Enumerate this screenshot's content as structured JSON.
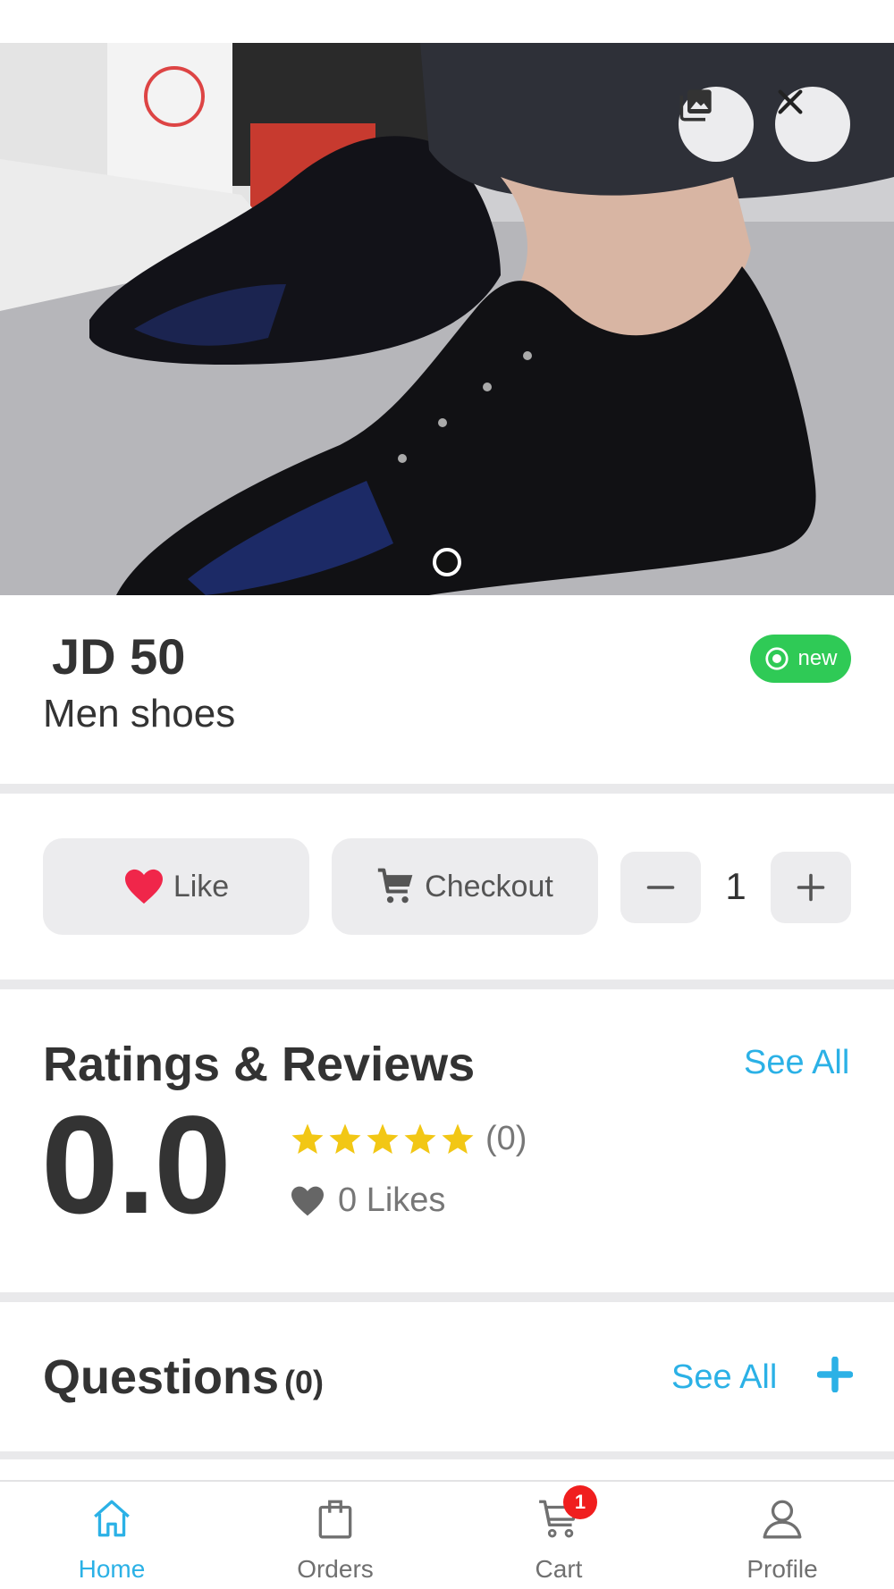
{
  "product": {
    "price": "JD 50",
    "name": "Men shoes",
    "condition_badge": "new"
  },
  "actions": {
    "like_label": "Like",
    "checkout_label": "Checkout",
    "quantity": "1"
  },
  "ratings": {
    "title": "Ratings & Reviews",
    "see_all": "See All",
    "average": "0.0",
    "stars_filled": 5,
    "review_count": "(0)",
    "likes": "0 Likes"
  },
  "questions": {
    "title": "Questions",
    "count": "(0)",
    "see_all": "See All"
  },
  "tabbar": {
    "tabs": [
      {
        "label": "Home",
        "icon": "home-icon",
        "active": true
      },
      {
        "label": "Orders",
        "icon": "shopping-bag-icon",
        "active": false
      },
      {
        "label": "Cart",
        "icon": "cart-icon",
        "active": false
      },
      {
        "label": "Profile",
        "icon": "user-icon",
        "active": false
      }
    ],
    "cart_badge": "1"
  },
  "colors": {
    "accent": "#2bb1e6",
    "badge_green": "#2fca56",
    "heart_red": "#f0264a",
    "star_yellow": "#f2c715",
    "cart_badge_red": "#f01e1e"
  }
}
